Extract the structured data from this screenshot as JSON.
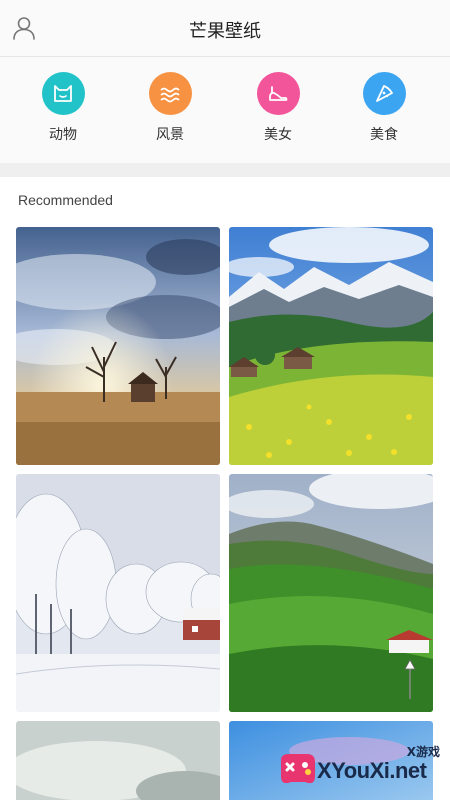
{
  "header": {
    "title": "芒果壁纸",
    "user_icon": "user-icon"
  },
  "categories": [
    {
      "label": "动物",
      "icon": "cat-face-icon",
      "color": "#22c3c8"
    },
    {
      "label": "风景",
      "icon": "waves-icon",
      "color": "#f79243"
    },
    {
      "label": "美女",
      "icon": "high-heel-icon",
      "color": "#f2559a"
    },
    {
      "label": "美食",
      "icon": "pizza-slice-icon",
      "color": "#3ba5f1"
    }
  ],
  "section": {
    "title": "Recommended"
  },
  "wallpapers": [
    {
      "subject": "dramatic sky over farmhouse and bare trees"
    },
    {
      "subject": "alpine meadow with yellow flowers and snowy mountains"
    },
    {
      "subject": "snowy forest with red cabin"
    },
    {
      "subject": "green rolling hills with red-roofed house"
    },
    {
      "subject": "cloudy sky"
    },
    {
      "subject": "blue sky"
    }
  ],
  "watermark": {
    "top": "X游戏",
    "main": "XYouXi.net"
  }
}
